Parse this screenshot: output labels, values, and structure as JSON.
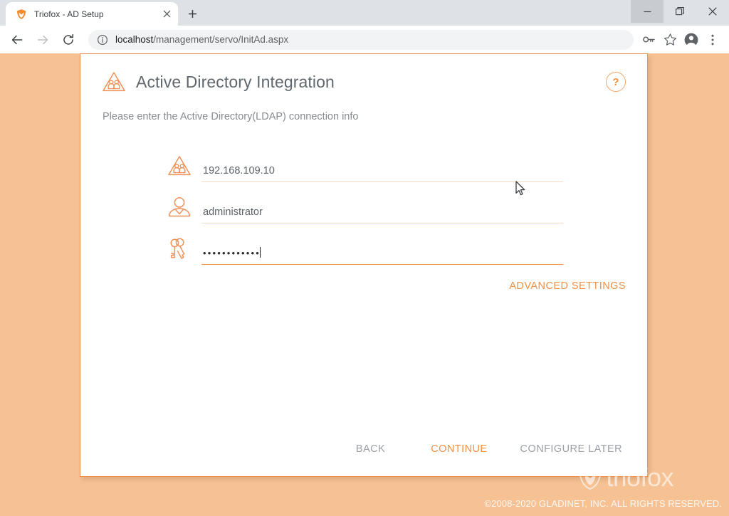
{
  "browser": {
    "tab": {
      "title": "Triofox - AD Setup",
      "favicon": "triofox-shield-icon",
      "close_label": "✕"
    },
    "newtab_label": "+",
    "window_controls": {
      "minimize": "—",
      "maximize": "❐",
      "close": "✕"
    },
    "nav": {
      "back": "←",
      "forward": "→",
      "reload": "⟳"
    },
    "omnibox": {
      "info_icon": "info-circle-icon",
      "url_host": "localhost",
      "url_path": "/management/servo/InitAd.aspx",
      "url_full": "localhost/management/servo/InitAd.aspx"
    },
    "toolbar_icons": {
      "password_key": "key-icon",
      "bookmark_star": "star-icon",
      "profile": "account-avatar-icon",
      "menu": "three-dot-menu-icon"
    }
  },
  "page": {
    "title": "Active Directory Integration",
    "title_icon": "active-directory-triangle-icon",
    "help_label": "?",
    "subtitle": "Please enter the Active Directory(LDAP) connection info",
    "fields": [
      {
        "name": "server",
        "icon": "active-directory-triangle-icon",
        "value": "192.168.109.10",
        "placeholder": "",
        "focused": false
      },
      {
        "name": "username",
        "icon": "user-icon",
        "value": "administrator",
        "placeholder": "",
        "focused": false
      },
      {
        "name": "password",
        "icon": "keys-icon",
        "value": "••••••••••••",
        "placeholder": "",
        "focused": true
      }
    ],
    "advanced_settings_label": "ADVANCED SETTINGS",
    "buttons": {
      "back": "BACK",
      "continue": "CONTINUE",
      "configure_later": "CONFIGURE LATER"
    }
  },
  "footer": {
    "watermark_text": "triofox",
    "watermark_logo": "triofox-shield-icon",
    "copyright": "©2008-2020 GLADINET, INC. ALL RIGHTS RESERVED."
  },
  "colors": {
    "page_background": "#f6c294",
    "accent_orange": "#f59042",
    "border_orange": "#ef8f4d",
    "title_gray": "#60686e",
    "muted_gray": "#9aa0a6"
  }
}
